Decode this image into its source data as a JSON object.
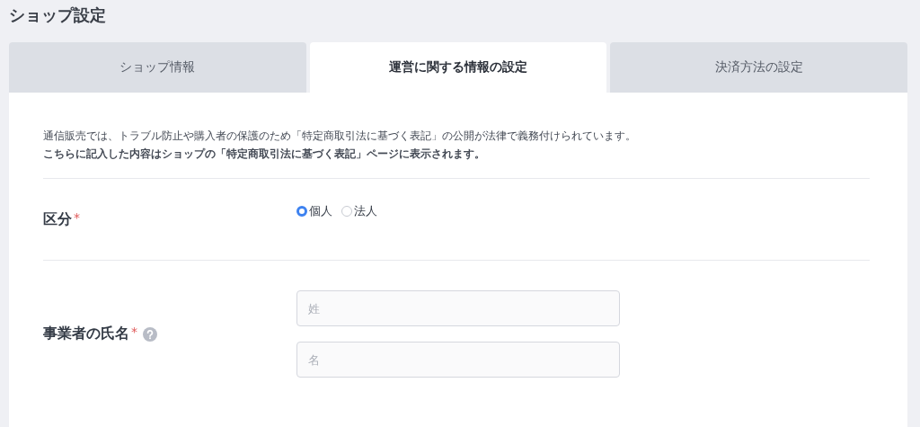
{
  "page_title": "ショップ設定",
  "tabs": [
    {
      "label": "ショップ情報",
      "selected": false
    },
    {
      "label": "運営に関する情報の設定",
      "selected": true
    },
    {
      "label": "決済方法の設定",
      "selected": false
    }
  ],
  "intro": [
    "通信販売では、トラブル防止や購入者の保護のため「特定商取引法に基づく表記」の公開が法律で義務付けられています。",
    "**こちらに記入した内容はショップの「特定商取引法に基づく表記」ページに表示されます。**"
  ],
  "fields": [
    {
      "kind": "radio",
      "label": "区分",
      "required_mark": "*",
      "options": [
        {
          "label": "個人",
          "selected": true
        },
        {
          "label": "法人",
          "selected": false
        }
      ]
    },
    {
      "kind": "inputs",
      "label": "事業者の氏名",
      "required_mark": "*",
      "help": true,
      "inputs": [
        {
          "placeholder": "姓"
        },
        {
          "placeholder": "名"
        }
      ]
    }
  ]
}
